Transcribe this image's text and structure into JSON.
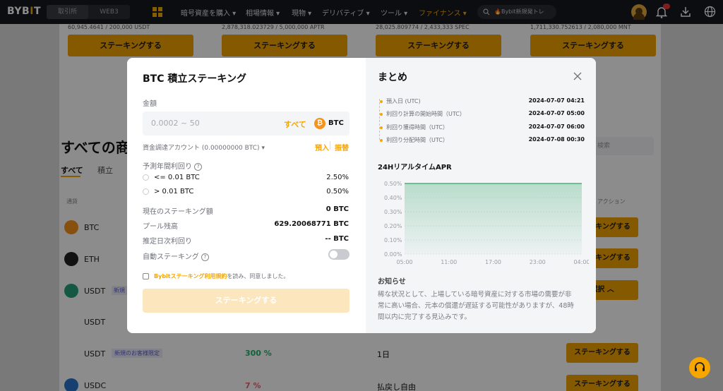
{
  "topnav": {
    "logo_main": "BYB",
    "logo_accent": "I",
    "logo_end": "T",
    "seg_exchange": "取引所",
    "seg_web3": "WEB3",
    "items": [
      "暗号資産を購入",
      "相場情報",
      "現物",
      "デリバティブ",
      "ツール",
      "ファイナンス"
    ],
    "search_placeholder": "🔥Bybit新規発トレ"
  },
  "background": {
    "card_numbers": [
      "60,945.4641 / 200,000 USDT",
      "2,878,318.023729 / 5,000,000 APTR",
      "28,025.809774 / 2,433,333 SPEC",
      "1,711,330.752613 / 2,080,000 MNT"
    ],
    "card_button": "ステーキングする",
    "section_title": "すべての商",
    "tab_all": "すべて",
    "tab_accum": "積立",
    "col_currency": "通貨",
    "col_action": "アクション",
    "search_placeholder": "検索",
    "rows": [
      {
        "coin": "BTC"
      },
      {
        "coin": "ETH"
      },
      {
        "coin": "USDT",
        "badge": "新規"
      },
      {
        "coin": "USDT"
      },
      {
        "coin": "USDT",
        "badge": "新規のお客様限定",
        "apr": "300 %",
        "term": "1日"
      },
      {
        "coin": "USDC",
        "apr": "7 %",
        "term": "払戻し自由"
      }
    ],
    "stake_button": "ステーキングする",
    "select_button": "選択"
  },
  "modal": {
    "title": "BTC 積立ステーキング",
    "amount_label": "金額",
    "amount_placeholder": "0.0002 ~ 50",
    "all_button": "すべて",
    "coin": "BTC",
    "funding_account": "資金調達アカウント (0.00000000 BTC)",
    "deposit_link": "預入",
    "transfer_link": "振替",
    "apr_label": "予測年間利回り",
    "tiers": [
      {
        "condition": "<= 0.01 BTC",
        "rate": "2.50%"
      },
      {
        "condition": "> 0.01 BTC",
        "rate": "0.50%"
      }
    ],
    "current_staking_label": "現在のステーキング額",
    "current_staking_value": "0 BTC",
    "pool_label": "プール残高",
    "pool_value": "629.20068771 BTC",
    "daily_label": "推定日次利回り",
    "daily_value": "-- BTC",
    "auto_label": "自動ステーキング",
    "terms_prefix": "Bybitステーキング利用規約",
    "terms_suffix": "を読み、同意しました。",
    "submit_button": "ステーキングする",
    "summary_title": "まとめ",
    "timeline": [
      {
        "label": "預入日 (UTC)",
        "value": "2024-07-07 04:21"
      },
      {
        "label": "利回り計算の開始時間（UTC）",
        "value": "2024-07-07 05:00"
      },
      {
        "label": "利回り獲得時間（UTC）",
        "value": "2024-07-07 06:00"
      },
      {
        "label": "利回り分配時間（UTC）",
        "value": "2024-07-08 00:30"
      }
    ],
    "apr_chart_title": "24HリアルタイムAPR",
    "notice_title": "お知らせ",
    "notice_text": "稀な状況として、上場している暗号資産に対する市場の需要が非常に高い場合、元本の償還が遅延する可能性がありますが、48時間以内に完了する見込みです。"
  },
  "chart_data": {
    "type": "area",
    "title": "24HリアルタイムAPR",
    "x": [
      "05:00",
      "11:00",
      "17:00",
      "23:00",
      "04:00"
    ],
    "y_ticks": [
      "0.00%",
      "0.10%",
      "0.20%",
      "0.30%",
      "0.40%",
      "0.50%"
    ],
    "ylim": [
      0,
      0.5
    ],
    "series": [
      {
        "values": [
          0.5,
          0.5,
          0.5,
          0.5,
          0.5
        ]
      }
    ],
    "color": "#4caf7d"
  }
}
